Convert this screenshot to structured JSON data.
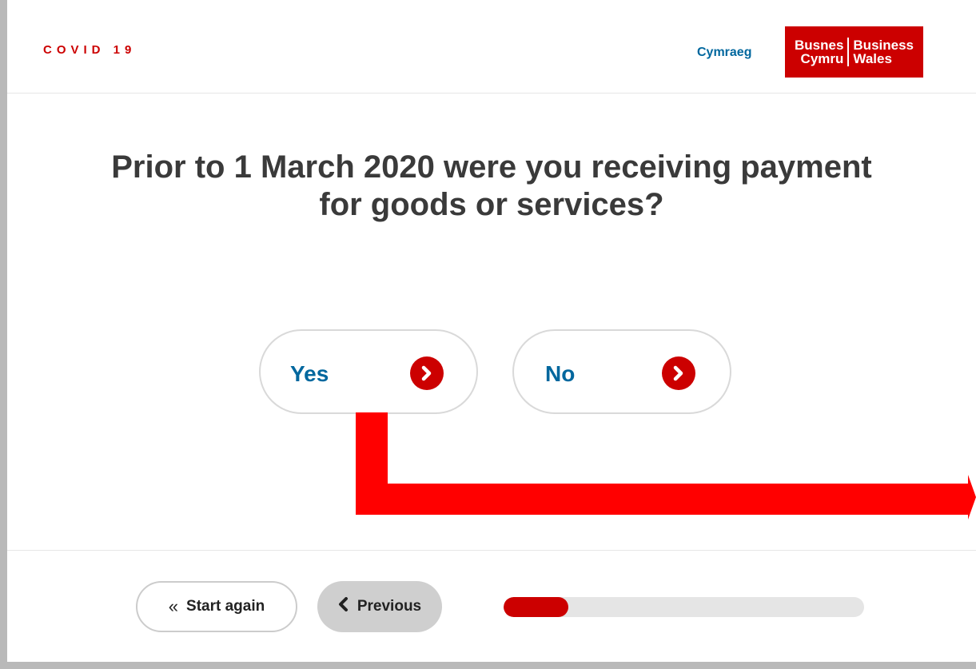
{
  "header": {
    "covid_label": "COVID 19",
    "language_link": "Cymraeg",
    "logo": {
      "left_line1": "Busnes",
      "left_line2": "Cymru",
      "right_line1": "Business",
      "right_line2": "Wales"
    }
  },
  "question": {
    "title": "Prior to 1 March 2020 were you receiving payment for goods or services?"
  },
  "answers": [
    {
      "label": "Yes",
      "icon": "chevron-right-icon"
    },
    {
      "label": "No",
      "icon": "chevron-right-icon"
    }
  ],
  "footer": {
    "start_again_label": "Start again",
    "start_again_icon": "double-chevron-left-icon",
    "previous_label": "Previous",
    "previous_icon": "chevron-left-icon",
    "progress_fraction": 0.18
  },
  "annotation": {
    "icon": "red-arrow-annotation"
  },
  "colors": {
    "brand_red": "#cc0000",
    "link_blue": "#00679e",
    "heading": "#3a3a3a",
    "annotation_red": "#ff0000",
    "progress_track": "#e5e5e5",
    "previous_bg": "#cfcfcf"
  }
}
